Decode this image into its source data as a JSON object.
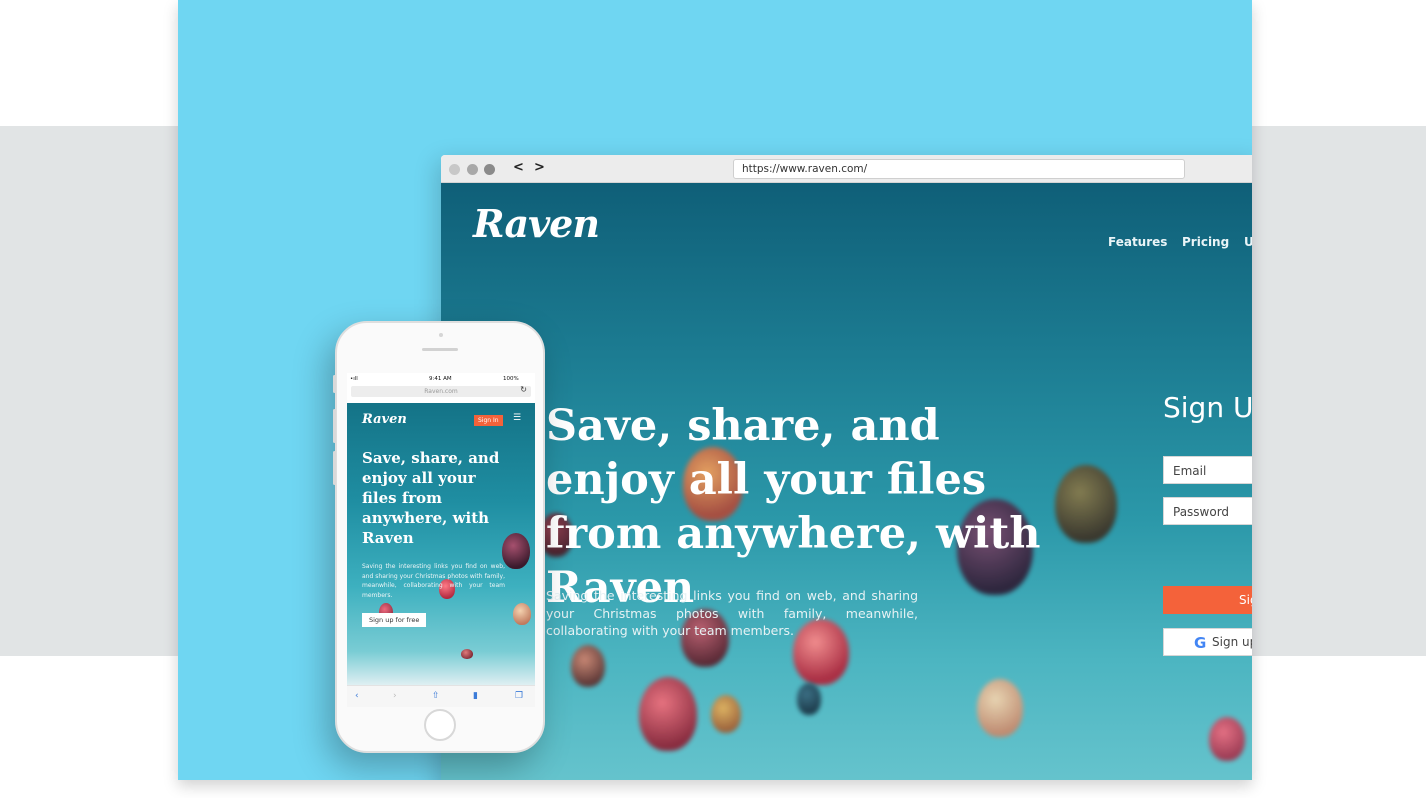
{
  "browser": {
    "url": "https://www.raven.com/",
    "back_label": "<",
    "forward_label": ">"
  },
  "desktop_site": {
    "logo": "Raven",
    "nav": [
      "Features",
      "Pricing",
      "U"
    ],
    "headline": "Save, share, and enjoy all your files from anywhere, with Raven",
    "subtext": "Saving the interesting links you find on web, and sharing your Christmas photos with family, meanwhile, collaborating with your team members.",
    "signup": {
      "title": "Sign U",
      "email_placeholder": "Email",
      "password_placeholder": "Password",
      "button_label": "Sig",
      "google_label": "Sign up",
      "google_glyph": "G"
    }
  },
  "phone": {
    "status_time": "9:41 AM",
    "status_battery": "100%",
    "status_signal": "•ıll",
    "url": "Raven.com",
    "reload_glyph": "↻",
    "menu_glyph": "☰",
    "site": {
      "logo": "Raven",
      "signin_label": "Sign In",
      "headline": "Save, share, and enjoy all your files from anywhere, with Raven",
      "subtext": "Saving the interesting links you find on web, and sharing your Christmas photos with family, meanwhile, collaborating with your team members.",
      "cta_label": "Sign up for free"
    },
    "toolbar_icons": [
      "back-icon",
      "forward-icon",
      "share-icon",
      "bookmarks-icon",
      "tabs-icon"
    ]
  },
  "colors": {
    "background_blue": "#6fd6f2",
    "band_gray": "#e1e4e5",
    "accent_orange": "#f4623a",
    "google_blue": "#4285f4"
  }
}
